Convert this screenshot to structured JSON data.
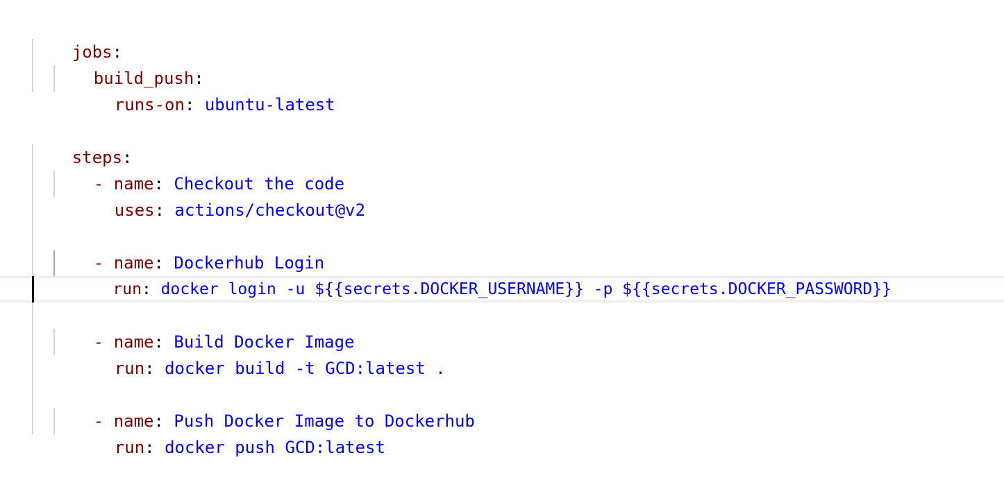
{
  "editor": {
    "lines": [
      {
        "key": "jobs",
        "sep": ":",
        "value": ""
      },
      {
        "key": "build_push",
        "sep": ":",
        "value": ""
      },
      {
        "key": "runs-on",
        "sep": ": ",
        "value": "ubuntu-latest"
      },
      {
        "key": "",
        "sep": "",
        "value": ""
      },
      {
        "key": "steps",
        "sep": ":",
        "value": ""
      },
      {
        "dash": "- ",
        "key": "name",
        "sep": ": ",
        "value": "Checkout the code"
      },
      {
        "key": "uses",
        "sep": ": ",
        "value": "actions/checkout@v2"
      },
      {
        "key": "",
        "sep": "",
        "value": ""
      },
      {
        "dash": "- ",
        "key": "name",
        "sep": ": ",
        "value": "Dockerhub Login"
      },
      {
        "key": "run",
        "sep": ": ",
        "value": "docker login -u ${{secrets.DOCKER_USERNAME}} -p ${{secrets.DOCKER_PASSWORD}}"
      },
      {
        "key": "",
        "sep": "",
        "value": ""
      },
      {
        "dash": "- ",
        "key": "name",
        "sep": ": ",
        "value": "Build Docker Image"
      },
      {
        "key": "run",
        "sep": ": ",
        "value": "docker build -t GCD:latest ."
      },
      {
        "key": "",
        "sep": "",
        "value": ""
      },
      {
        "dash": "- ",
        "key": "name",
        "sep": ": ",
        "value": "Push Docker Image to Dockerhub"
      },
      {
        "key": "run",
        "sep": ": ",
        "value": "docker push GCD:latest"
      }
    ]
  },
  "colors": {
    "key": "#800000",
    "value": "#0000ff",
    "punctuation": "#000000",
    "indent_guide": "#d3d3d3",
    "current_line_border": "#eeeeee"
  }
}
